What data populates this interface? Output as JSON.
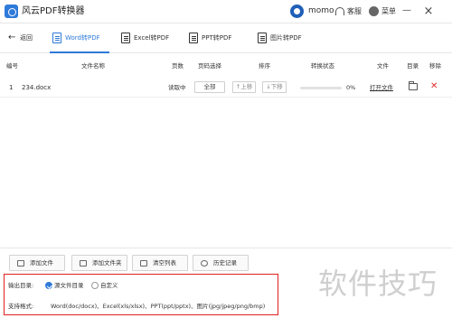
{
  "app": {
    "title": "风云PDF转换器"
  },
  "header": {
    "username": "momo",
    "service_label": "客服",
    "menu_label": "菜单",
    "minimize_glyph": "—",
    "close_glyph": "×"
  },
  "nav": {
    "back_label": "返回",
    "tabs": [
      {
        "label": "Word转PDF",
        "active": true
      },
      {
        "label": "Excel转PDF",
        "active": false
      },
      {
        "label": "PPT转PDF",
        "active": false
      },
      {
        "label": "图片转PDF",
        "active": false
      }
    ]
  },
  "table": {
    "columns": [
      "编号",
      "文件名称",
      "页数",
      "页码选择",
      "排序",
      "转换状态",
      "文件",
      "目录",
      "移除"
    ],
    "rows": [
      {
        "index": "1",
        "filename": "234.docx",
        "pages": "读取中",
        "page_select": "全部",
        "move_up": "↑上移",
        "move_down": "↓下移",
        "progress": 0,
        "progress_text": "0%",
        "open_file": "打开文件"
      }
    ]
  },
  "toolbar": {
    "add_file": "添加文件",
    "add_folder": "添加文件夹",
    "clear_list": "清空列表",
    "history": "历史记录"
  },
  "settings": {
    "output_dir_label": "输出目录:",
    "option_source": "源文件目录",
    "option_custom": "自定义",
    "selected": "源文件目录",
    "formats_label": "支持格式:",
    "formats_text": "Word(doc/docx)、Excel(xls/xlsx)、PPT(ppt/pptx)、图片(jpg/jpeg/png/bmp)"
  },
  "watermark": "软件技巧",
  "colors": {
    "accent": "#2f7ad9",
    "highlight_border": "#e02020",
    "delete": "#e02b2b"
  }
}
